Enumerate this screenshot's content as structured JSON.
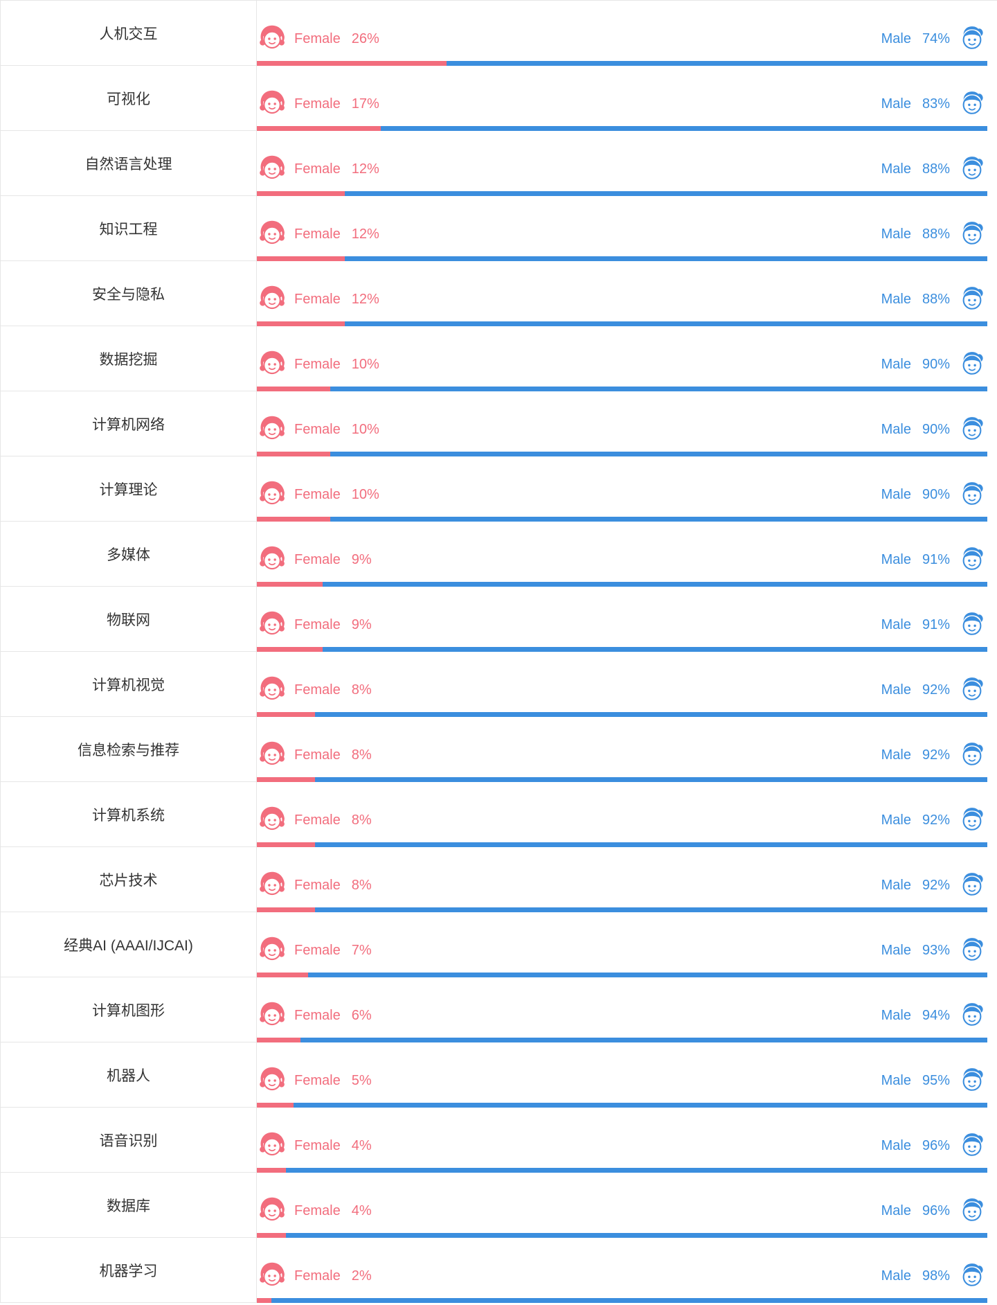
{
  "labels": {
    "female": "Female",
    "male": "Male"
  },
  "colors": {
    "female": "#f26d7d",
    "male": "#3b8ede",
    "border": "#e6e6e6"
  },
  "rows": [
    {
      "category": "人机交互",
      "female_pct": "26%",
      "male_pct": "74%",
      "female_val": 26
    },
    {
      "category": "可视化",
      "female_pct": "17%",
      "male_pct": "83%",
      "female_val": 17
    },
    {
      "category": "自然语言处理",
      "female_pct": "12%",
      "male_pct": "88%",
      "female_val": 12
    },
    {
      "category": "知识工程",
      "female_pct": "12%",
      "male_pct": "88%",
      "female_val": 12
    },
    {
      "category": "安全与隐私",
      "female_pct": "12%",
      "male_pct": "88%",
      "female_val": 12
    },
    {
      "category": "数据挖掘",
      "female_pct": "10%",
      "male_pct": "90%",
      "female_val": 10
    },
    {
      "category": "计算机网络",
      "female_pct": "10%",
      "male_pct": "90%",
      "female_val": 10
    },
    {
      "category": "计算理论",
      "female_pct": "10%",
      "male_pct": "90%",
      "female_val": 10
    },
    {
      "category": "多媒体",
      "female_pct": "9%",
      "male_pct": "91%",
      "female_val": 9
    },
    {
      "category": "物联网",
      "female_pct": "9%",
      "male_pct": "91%",
      "female_val": 9
    },
    {
      "category": "计算机视觉",
      "female_pct": "8%",
      "male_pct": "92%",
      "female_val": 8
    },
    {
      "category": "信息检索与推荐",
      "female_pct": "8%",
      "male_pct": "92%",
      "female_val": 8
    },
    {
      "category": "计算机系统",
      "female_pct": "8%",
      "male_pct": "92%",
      "female_val": 8
    },
    {
      "category": "芯片技术",
      "female_pct": "8%",
      "male_pct": "92%",
      "female_val": 8
    },
    {
      "category": "经典AI (AAAI/IJCAI)",
      "female_pct": "7%",
      "male_pct": "93%",
      "female_val": 7
    },
    {
      "category": "计算机图形",
      "female_pct": "6%",
      "male_pct": "94%",
      "female_val": 6
    },
    {
      "category": "机器人",
      "female_pct": "5%",
      "male_pct": "95%",
      "female_val": 5
    },
    {
      "category": "语音识别",
      "female_pct": "4%",
      "male_pct": "96%",
      "female_val": 4
    },
    {
      "category": "数据库",
      "female_pct": "4%",
      "male_pct": "96%",
      "female_val": 4
    },
    {
      "category": "机器学习",
      "female_pct": "2%",
      "male_pct": "98%",
      "female_val": 2
    }
  ],
  "chart_data": {
    "type": "bar",
    "orientation": "horizontal-stacked",
    "title": "",
    "xlabel": "",
    "ylabel": "",
    "categories": [
      "人机交互",
      "可视化",
      "自然语言处理",
      "知识工程",
      "安全与隐私",
      "数据挖掘",
      "计算机网络",
      "计算理论",
      "多媒体",
      "物联网",
      "计算机视觉",
      "信息检索与推荐",
      "计算机系统",
      "芯片技术",
      "经典AI (AAAI/IJCAI)",
      "计算机图形",
      "机器人",
      "语音识别",
      "数据库",
      "机器学习"
    ],
    "series": [
      {
        "name": "Female",
        "values": [
          26,
          17,
          12,
          12,
          12,
          10,
          10,
          10,
          9,
          9,
          8,
          8,
          8,
          8,
          7,
          6,
          5,
          4,
          4,
          2
        ],
        "color": "#f26d7d"
      },
      {
        "name": "Male",
        "values": [
          74,
          83,
          88,
          88,
          88,
          90,
          90,
          90,
          91,
          91,
          92,
          92,
          92,
          92,
          93,
          94,
          95,
          96,
          96,
          98
        ],
        "color": "#3b8ede"
      }
    ],
    "xlim": [
      0,
      100
    ]
  }
}
